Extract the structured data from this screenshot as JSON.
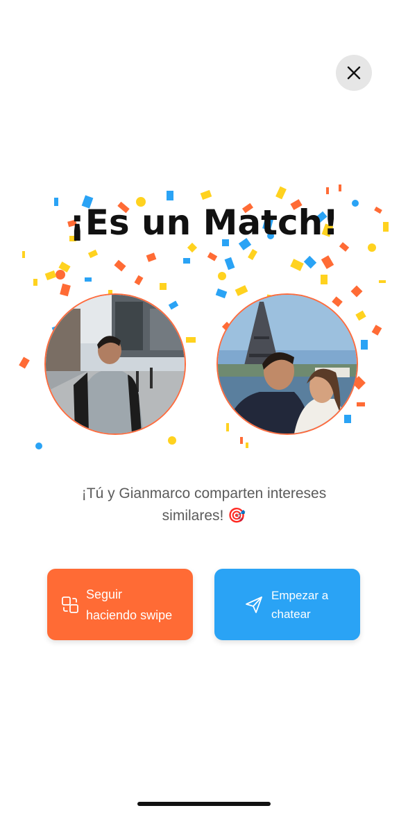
{
  "header": {
    "close_button": {
      "icon": "close-icon"
    }
  },
  "match": {
    "title": "¡Es un Match!",
    "subtitle_line1": "¡Tú y Gianmarco comparten intereses",
    "subtitle_line2": "similares! 🎯",
    "photos": [
      {
        "alt": "user-photo-street"
      },
      {
        "alt": "match-photo-eiffel-tower"
      }
    ]
  },
  "actions": {
    "swipe_button": {
      "line1": "Seguir",
      "line2": "haciendo swipe",
      "icon": "swap-icon"
    },
    "chat_button": {
      "line1": "Empezar a",
      "line2": "chatear",
      "icon": "send-icon"
    }
  },
  "colors": {
    "orange": "#ff6b35",
    "blue": "#2aa3f5",
    "yellow": "#ffd21f"
  }
}
